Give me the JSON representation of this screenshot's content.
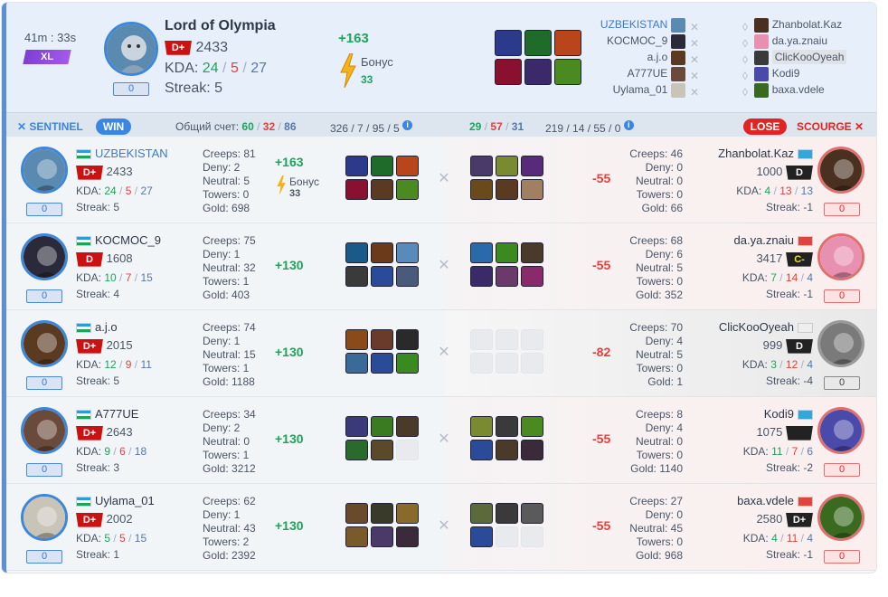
{
  "match": {
    "duration": "41m : 33s",
    "size_badge": "XL"
  },
  "mvp": {
    "name": "Lord of Olympia",
    "rank": "D+",
    "rating": "2433",
    "kda": {
      "k": "24",
      "d": "5",
      "a": "27"
    },
    "streak": "Streak: 5",
    "badge": "0",
    "bonus_delta": "+163",
    "bonus_label": "Бонус",
    "bonus_value": "33",
    "items": [
      "#2b3a8a",
      "#1f6b2a",
      "#b8461a",
      "#8a1030",
      "#3a2a6a",
      "#4a8a20"
    ]
  },
  "roster": {
    "left": [
      "UZBEKISTAN",
      "KOCMOC_9",
      "a.j.o",
      "A777UE",
      "Uylama_01"
    ],
    "right": [
      "Zhanbolat.Kaz",
      "da.ya.znaiu",
      "ClicKooOyeah",
      "Kodi9",
      "baxa.vdele"
    ]
  },
  "teambar": {
    "sentinel": "SENTINEL",
    "win": "WIN",
    "score_label": "Общий счет:",
    "score_a": "60",
    "score_b": "32",
    "score_c": "86",
    "agg_left": "326 / 7 / 95 / 5",
    "right_a": "29",
    "right_b": "57",
    "right_c": "31",
    "agg_right": "219 / 14 / 55 / 0",
    "lose": "LOSE",
    "scourge": "SCOURGE"
  },
  "rows": [
    {
      "left": {
        "name": "UZBEKISTAN",
        "rank": "D+",
        "rating": "2433",
        "k": "24",
        "d": "5",
        "a": "27",
        "streak": "Streak: 5",
        "badge": "0",
        "creeps": "Creeps: 81",
        "deny": "Deny: 2",
        "neutral": "Neutral: 5",
        "towers": "Towers: 0",
        "gold": "Gold: 698",
        "delta": "+163",
        "bonus_value": "33",
        "items": [
          "#2b3a8a",
          "#1f6b2a",
          "#b8461a",
          "#8a1030",
          "#5a3a20",
          "#4a8a20"
        ]
      },
      "right": {
        "name": "Zhanbolat.Kaz",
        "rank": "D",
        "rating": "1000",
        "k": "4",
        "d": "13",
        "a": "13",
        "streak": "Streak: -1",
        "badge": "0",
        "creeps": "Creeps: 46",
        "deny": "Deny: 0",
        "neutral": "Neutral: 0",
        "towers": "Towers: 0",
        "gold": "Gold: 66",
        "delta": "-55",
        "items": [
          "#4a3a6a",
          "#7a8a30",
          "#5a2a7a",
          "#6a4a1a",
          "#5a3a20",
          "#a08060"
        ]
      }
    },
    {
      "left": {
        "name": "KOCMOC_9",
        "rank": "D",
        "rating": "1608",
        "k": "10",
        "d": "7",
        "a": "15",
        "streak": "Streak: 4",
        "badge": "0",
        "creeps": "Creeps: 75",
        "deny": "Deny: 1",
        "neutral": "Neutral: 32",
        "towers": "Towers: 1",
        "gold": "Gold: 403",
        "delta": "+130",
        "items": [
          "#1a5a8a",
          "#6a3a1a",
          "#5a8aba",
          "#3a3a3a",
          "#2a4a9a",
          "#4a5a7a"
        ]
      },
      "right": {
        "name": "da.ya.znaiu",
        "rank": "C-",
        "rating": "3417",
        "k": "7",
        "d": "14",
        "a": "4",
        "streak": "Streak: -1",
        "badge": "0",
        "creeps": "Creeps: 68",
        "deny": "Deny: 6",
        "neutral": "Neutral: 5",
        "towers": "Towers: 0",
        "gold": "Gold: 352",
        "delta": "-55",
        "items": [
          "#2a6aaa",
          "#3a8a20",
          "#4a3a2a",
          "#3a2a6a",
          "#6a3a6a",
          "#8a2a6a"
        ]
      }
    },
    {
      "left": {
        "name": "a.j.o",
        "rank": "D+",
        "rating": "2015",
        "k": "12",
        "d": "9",
        "a": "11",
        "streak": "Streak: 5",
        "badge": "0",
        "creeps": "Creeps: 74",
        "deny": "Deny: 1",
        "neutral": "Neutral: 15",
        "towers": "Towers: 1",
        "gold": "Gold: 1188",
        "delta": "+130",
        "items": [
          "#8a4a1a",
          "#6a3a2a",
          "#2a2a2a",
          "#3a6a9a",
          "#2a4a9a",
          "#3a8a20"
        ]
      },
      "right": {
        "name": "ClicKooOyeah",
        "rank": "D",
        "rating": "999",
        "k": "3",
        "d": "12",
        "a": "4",
        "streak": "Streak: -4",
        "badge": "0",
        "creeps": "Creeps: 70",
        "deny": "Deny: 4",
        "neutral": "Neutral: 5",
        "towers": "Towers: 0",
        "gold": "Gold: 1",
        "delta": "-82",
        "items": [
          "",
          "",
          "",
          "",
          "",
          ""
        ]
      }
    },
    {
      "left": {
        "name": "A777UE",
        "rank": "D+",
        "rating": "2643",
        "k": "9",
        "d": "6",
        "a": "18",
        "streak": "Streak: 3",
        "badge": "0",
        "creeps": "Creeps: 34",
        "deny": "Deny: 2",
        "neutral": "Neutral: 0",
        "towers": "Towers: 1",
        "gold": "Gold: 3212",
        "delta": "+130",
        "items": [
          "#3a3a7a",
          "#3a7a20",
          "#4a3a2a",
          "#2a6a2a",
          "#5a4a2a",
          ""
        ]
      },
      "right": {
        "name": "Kodi9",
        "rank": "",
        "rating": "1075",
        "k": "11",
        "d": "7",
        "a": "6",
        "streak": "Streak: -2",
        "badge": "0",
        "creeps": "Creeps: 8",
        "deny": "Deny: 4",
        "neutral": "Neutral: 0",
        "towers": "Towers: 0",
        "gold": "Gold: 1140",
        "delta": "-55",
        "items": [
          "#7a8a30",
          "#3a3a3a",
          "#4a8a20",
          "#2a4a9a",
          "#4a3a2a",
          "#3a2a3a"
        ]
      }
    },
    {
      "left": {
        "name": "Uylama_01",
        "rank": "D+",
        "rating": "2002",
        "k": "5",
        "d": "5",
        "a": "15",
        "streak": "Streak: 1",
        "badge": "0",
        "creeps": "Creeps: 62",
        "deny": "Deny: 1",
        "neutral": "Neutral: 43",
        "towers": "Towers: 2",
        "gold": "Gold: 2392",
        "delta": "+130",
        "items": [
          "#6a4a2a",
          "#3a3a2a",
          "#8a6a2a",
          "#7a5a2a",
          "#4a3a6a",
          "#3a2a3a"
        ]
      },
      "right": {
        "name": "baxa.vdele",
        "rank": "D+",
        "rating": "2580",
        "k": "4",
        "d": "11",
        "a": "4",
        "streak": "Streak: -1",
        "badge": "0",
        "creeps": "Creeps: 27",
        "deny": "Deny: 0",
        "neutral": "Neutral: 45",
        "towers": "Towers: 0",
        "gold": "Gold: 968",
        "delta": "-55",
        "items": [
          "#5a6a3a",
          "#3a3a3a",
          "#5a5a5a",
          "#2a4a9a",
          "",
          ""
        ]
      }
    }
  ]
}
